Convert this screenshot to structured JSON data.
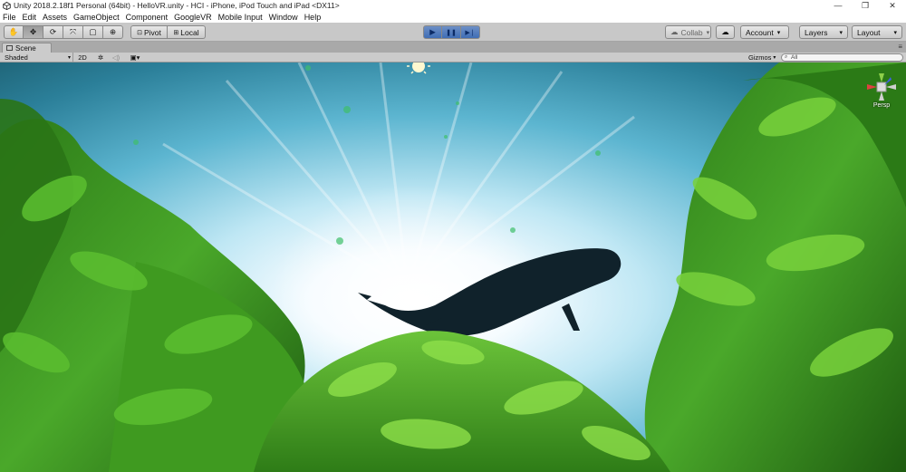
{
  "window": {
    "title": "Unity 2018.2.18f1 Personal (64bit) - HelloVR.unity - HCI - iPhone, iPod Touch and iPad <DX11>",
    "controls": [
      "—",
      "❐",
      "✕"
    ]
  },
  "menu": [
    "File",
    "Edit",
    "Assets",
    "GameObject",
    "Component",
    "GoogleVR",
    "Mobile Input",
    "Window",
    "Help"
  ],
  "toolbar": {
    "transform_tools": [
      {
        "name": "hand-tool",
        "glyph": "✋"
      },
      {
        "name": "move-tool",
        "glyph": "✥"
      },
      {
        "name": "rotate-tool",
        "glyph": "⟳"
      },
      {
        "name": "scale-tool",
        "glyph": "⤧"
      },
      {
        "name": "rect-tool",
        "glyph": "▢"
      },
      {
        "name": "transform-tool",
        "glyph": "⊕"
      }
    ],
    "pivot_label": "Pivot",
    "local_label": "Local",
    "play_glyph": "▶",
    "pause_glyph": "❚❚",
    "step_glyph": "▶❘",
    "collab_label": "Collab",
    "account_label": "Account",
    "layers_label": "Layers",
    "layout_label": "Layout",
    "caret": "▾"
  },
  "scene": {
    "tab_label": "Scene",
    "shading_mode": "Shaded",
    "mode_2d": "2D",
    "gizmos_label": "Gizmos",
    "search_placeholder": "All",
    "gizmo_projection": "Persp",
    "sky_color": "#3aa8c8",
    "foliage_color": "#3f9a20"
  }
}
